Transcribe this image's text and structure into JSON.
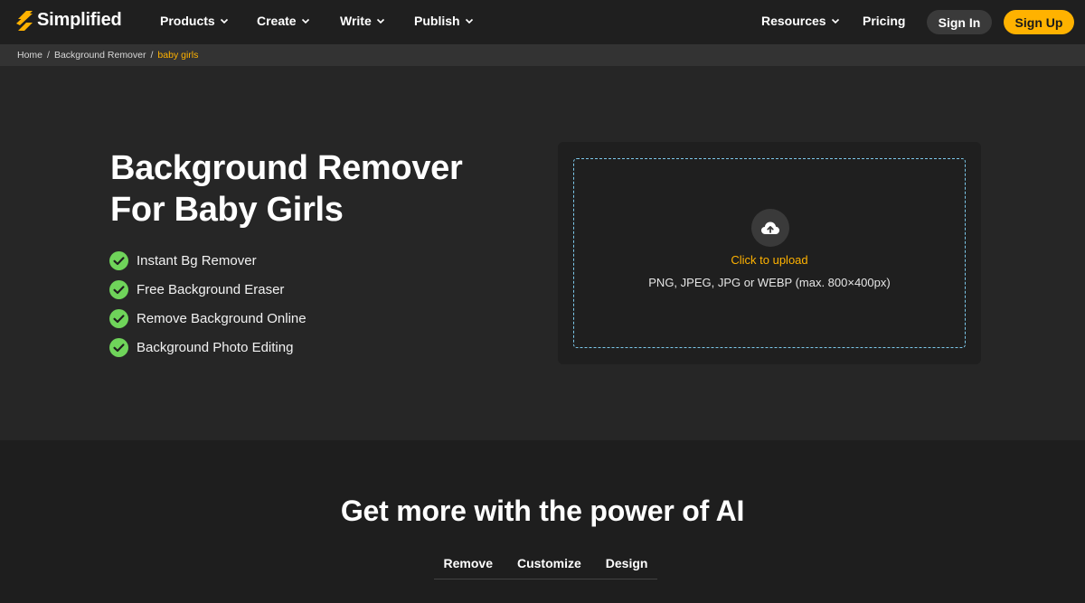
{
  "brand": {
    "name": "Simplified",
    "accent": "#ffb200"
  },
  "nav": {
    "left_items": [
      {
        "label": "Products"
      },
      {
        "label": "Create"
      },
      {
        "label": "Write"
      },
      {
        "label": "Publish"
      }
    ],
    "resources_label": "Resources",
    "pricing_label": "Pricing",
    "signin_label": "Sign In",
    "signup_label": "Sign Up"
  },
  "breadcrumb": {
    "items": [
      "Home",
      "Background Remover"
    ],
    "current": "baby girls"
  },
  "hero": {
    "title_line1": "Background Remover",
    "title_line2": "For Baby Girls",
    "features": [
      "Instant Bg Remover",
      "Free Background Eraser",
      "Remove Background Online",
      "Background Photo Editing"
    ]
  },
  "upload": {
    "link_text": "Click to upload",
    "hint": "PNG, JPEG, JPG or WEBP (max. 800×400px)",
    "icon": "cloud-upload-icon"
  },
  "lower": {
    "title": "Get more with the power of AI",
    "tabs": [
      "Remove",
      "Customize",
      "Design"
    ]
  }
}
